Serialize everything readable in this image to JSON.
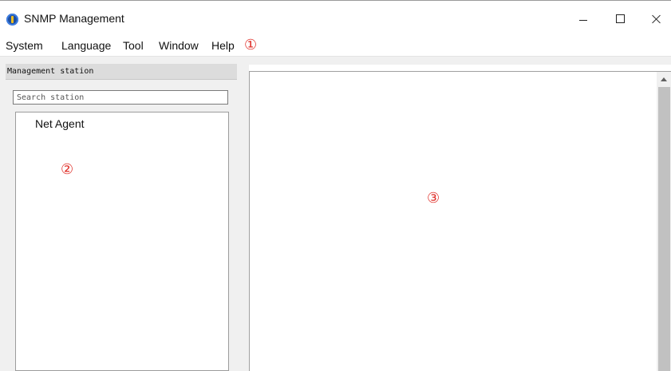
{
  "window": {
    "title": "SNMP Management",
    "icon": "app-logo-icon"
  },
  "menu": {
    "items": [
      "System",
      "Language",
      "Tool",
      "Window",
      "Help"
    ]
  },
  "callouts": [
    "①",
    "②",
    "③"
  ],
  "left_panel": {
    "header": "Management station",
    "search_placeholder": "Search station",
    "tree_items": [
      "Net Agent"
    ]
  },
  "colors": {
    "callout": "#e0302a",
    "panel_bg": "#f0f0f0",
    "header_bg": "#dcdcdc",
    "app_icon": "#1f4fa0"
  }
}
